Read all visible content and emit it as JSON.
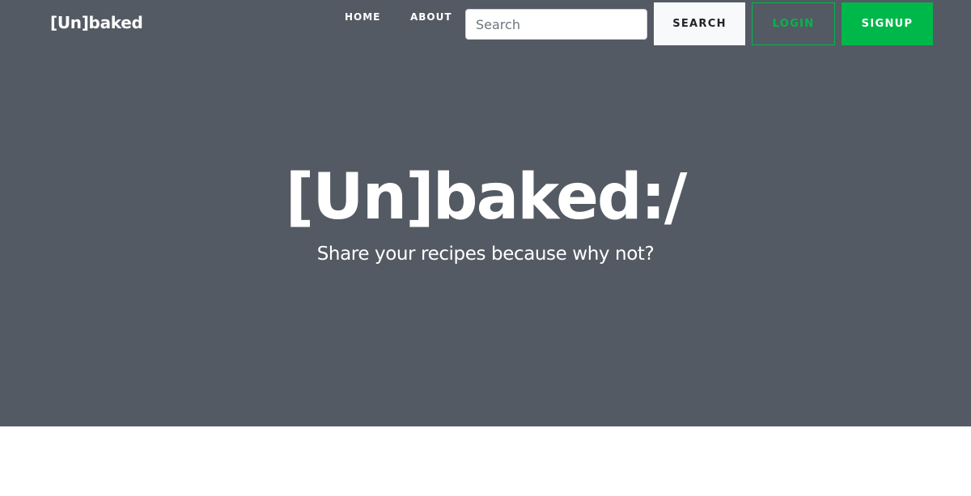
{
  "navbar": {
    "brand": "[Un]baked",
    "links": [
      {
        "label": "HOME"
      },
      {
        "label": "ABOUT"
      }
    ],
    "search": {
      "placeholder": "Search",
      "value": "",
      "button_label": "SEARCH"
    },
    "login_label": "LOGIN",
    "signup_label": "SIGNUP"
  },
  "hero": {
    "title": "[Un]baked:/",
    "subtitle": "Share your recipes because why not?"
  },
  "colors": {
    "hero_background": "#545a63",
    "accent_green": "#00b74a",
    "light_button": "#f8f9fa",
    "page_background": "#ffffff"
  }
}
